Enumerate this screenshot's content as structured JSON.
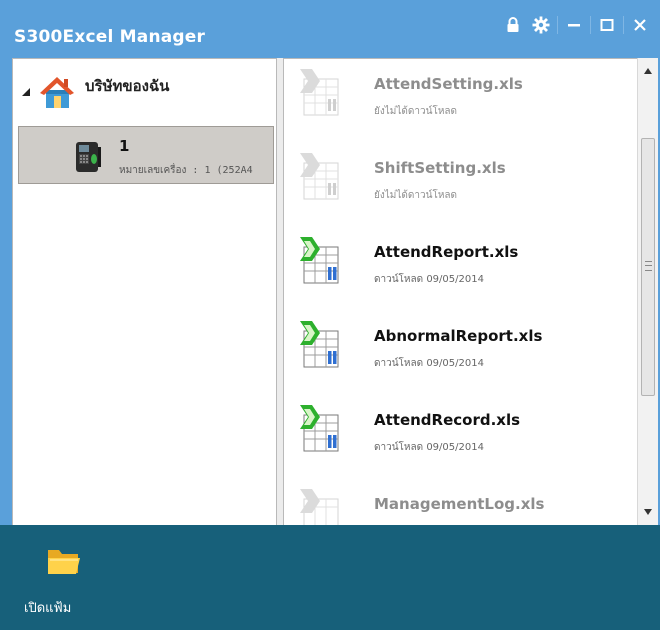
{
  "window": {
    "title": "S300Excel Manager",
    "title_icons": [
      "lock-icon",
      "gear-icon",
      "minimize-icon",
      "maximize-icon",
      "close-icon"
    ]
  },
  "tree": {
    "root_label": "บริษัทของฉัน",
    "device": {
      "name": "1",
      "subtitle": "หมายเลขเครื่อง : 1 (252A4"
    }
  },
  "files": [
    {
      "name": "AttendSetting.xls",
      "status": "ยังไม่ได้ดาวน์โหลด",
      "downloaded": false
    },
    {
      "name": "ShiftSetting.xls",
      "status": "ยังไม่ได้ดาวน์โหลด",
      "downloaded": false
    },
    {
      "name": "AttendReport.xls",
      "status": "ดาวน์โหลด 09/05/2014",
      "downloaded": true
    },
    {
      "name": "AbnormalReport.xls",
      "status": "ดาวน์โหลด 09/05/2014",
      "downloaded": true
    },
    {
      "name": "AttendRecord.xls",
      "status": "ดาวน์โหลด 09/05/2014",
      "downloaded": true
    },
    {
      "name": "ManagementLog.xls",
      "status": "",
      "downloaded": false
    }
  ],
  "footer": {
    "open_folder_label": "เปิดแฟ้ม"
  },
  "colors": {
    "titlebar": "#5aa0da",
    "footer": "#17607a"
  }
}
